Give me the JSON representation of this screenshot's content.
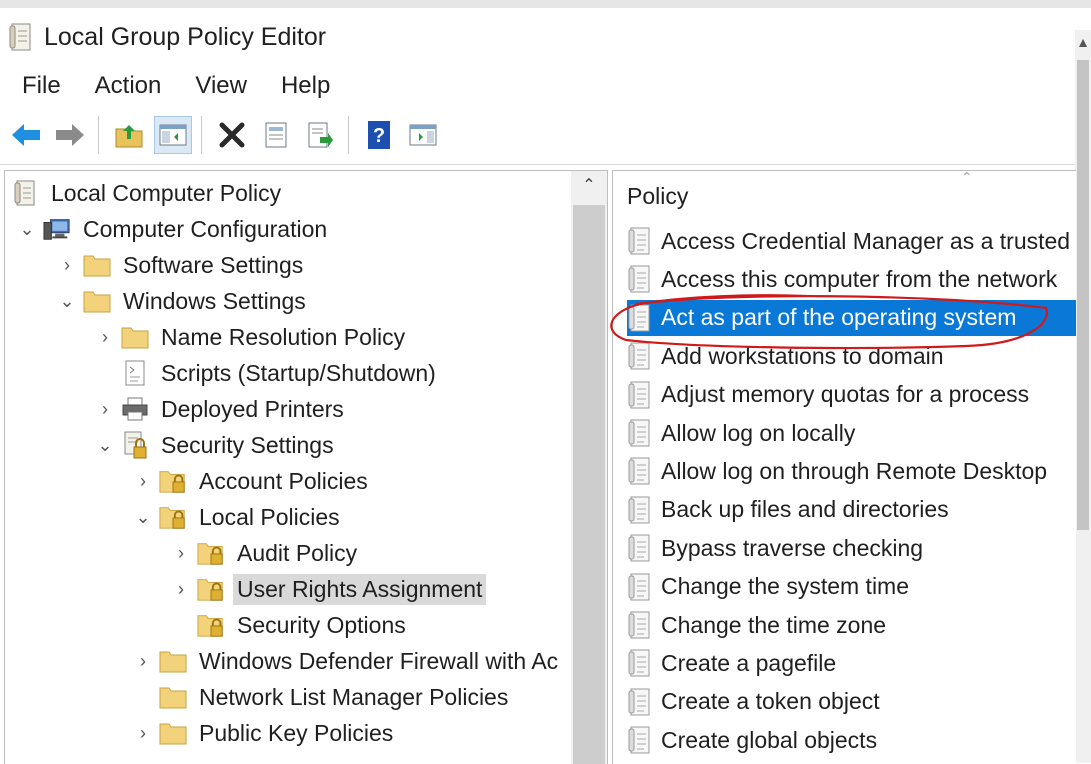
{
  "window": {
    "title": "Local Group Policy Editor"
  },
  "menu": [
    "File",
    "Action",
    "View",
    "Help"
  ],
  "toolbar_icons": [
    "back-arrow-icon",
    "forward-arrow-icon",
    "up-folder-icon",
    "show-hide-tree-icon",
    "delete-icon",
    "properties-icon",
    "export-list-icon",
    "help-icon",
    "show-action-pane-icon"
  ],
  "tree": [
    {
      "label": "Local Computer Policy"
    },
    {
      "label": "Computer Configuration"
    },
    {
      "label": "Software Settings"
    },
    {
      "label": "Windows Settings"
    },
    {
      "label": "Name Resolution Policy"
    },
    {
      "label": "Scripts (Startup/Shutdown)"
    },
    {
      "label": "Deployed Printers"
    },
    {
      "label": "Security Settings"
    },
    {
      "label": "Account Policies"
    },
    {
      "label": "Local Policies"
    },
    {
      "label": "Audit Policy"
    },
    {
      "label": "User Rights Assignment"
    },
    {
      "label": "Security Options"
    },
    {
      "label": "Windows Defender Firewall with Ac"
    },
    {
      "label": "Network List Manager Policies"
    },
    {
      "label": "Public Key Policies"
    }
  ],
  "policy_pane": {
    "column_header": "Policy",
    "items": [
      "Access Credential Manager as a trusted",
      "Access this computer from the network",
      "Act as part of the operating system",
      "Add workstations to domain",
      "Adjust memory quotas for a process",
      "Allow log on locally",
      "Allow log on through Remote Desktop",
      "Back up files and directories",
      "Bypass traverse checking",
      "Change the system time",
      "Change the time zone",
      "Create a pagefile",
      "Create a token object",
      "Create global objects"
    ],
    "selected": "Act as part of the operating system"
  },
  "colors": {
    "selection": "#0a78d7",
    "annotation": "#d01a1a"
  }
}
